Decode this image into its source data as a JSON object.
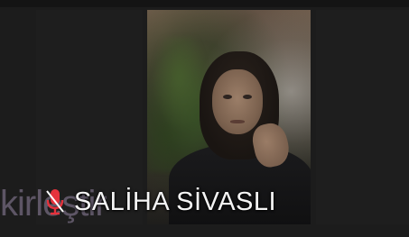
{
  "participant": {
    "name": "SALİHA SİVASLI",
    "mic_status": "muted",
    "mic_icon": "mic-muted-icon"
  },
  "watermark": {
    "text": "kirleştir"
  },
  "colors": {
    "background": "#1c1c1c",
    "name_text": "#f4f4f4",
    "mic_muted": "#e5323c"
  }
}
